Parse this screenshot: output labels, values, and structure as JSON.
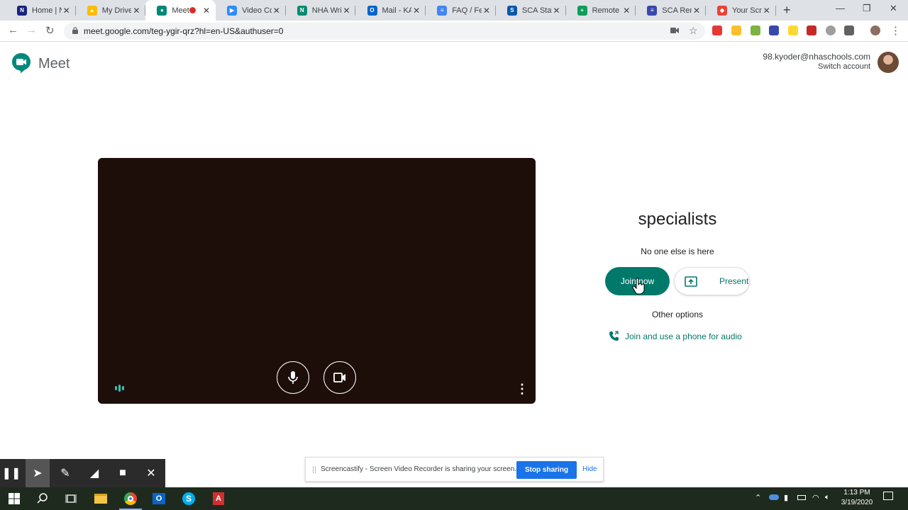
{
  "browser": {
    "tabs": [
      {
        "label": "Home | N",
        "color": "#1a237e",
        "glyph": "N"
      },
      {
        "label": "My Drive",
        "color": "#fbbc04",
        "glyph": "▲"
      },
      {
        "label": "Meet",
        "color": "#00897b",
        "glyph": "●",
        "active": true,
        "recording": true
      },
      {
        "label": "Video Co",
        "color": "#2d8cff",
        "glyph": "▶"
      },
      {
        "label": "NHA Writ",
        "color": "#0b8a6f",
        "glyph": "N"
      },
      {
        "label": "Mail - KA",
        "color": "#0a64c8",
        "glyph": "O"
      },
      {
        "label": "FAQ / Fe",
        "color": "#4285f4",
        "glyph": "≡"
      },
      {
        "label": "SCA Staff",
        "color": "#0b57a8",
        "glyph": "S"
      },
      {
        "label": "Remote L",
        "color": "#0f9d58",
        "glyph": "+"
      },
      {
        "label": "SCA Rem",
        "color": "#3949ab",
        "glyph": "≡"
      },
      {
        "label": "Your Scre",
        "color": "#ea4335",
        "glyph": "◆"
      }
    ],
    "new_tab": "+",
    "window_controls": {
      "minimize": "—",
      "restore": "❐",
      "close": "✕"
    },
    "url": "meet.google.com/teg-ygir-qrz?hl=en-US&authuser=0"
  },
  "meet": {
    "app_name": "Meet",
    "account_email": "98.kyoder@nhaschools.com",
    "switch_account": "Switch account",
    "meeting_name": "specialists",
    "status": "No one else is here",
    "join_label": "Join now",
    "present_label": "Present",
    "other_options": "Other options",
    "phone_audio": "Join and use a phone for audio",
    "more_options": "⋮"
  },
  "screencastify": {
    "share_text": "Screencastify - Screen Video Recorder is sharing your screen.",
    "stop_label": "Stop sharing",
    "hide_label": "Hide"
  },
  "taskbar": {
    "time": "1:13 PM",
    "date": "3/19/2020"
  },
  "colors": {
    "accent": "#00796b",
    "chrome_bg": "#dee1e6",
    "stop_button": "#1a73e8"
  }
}
